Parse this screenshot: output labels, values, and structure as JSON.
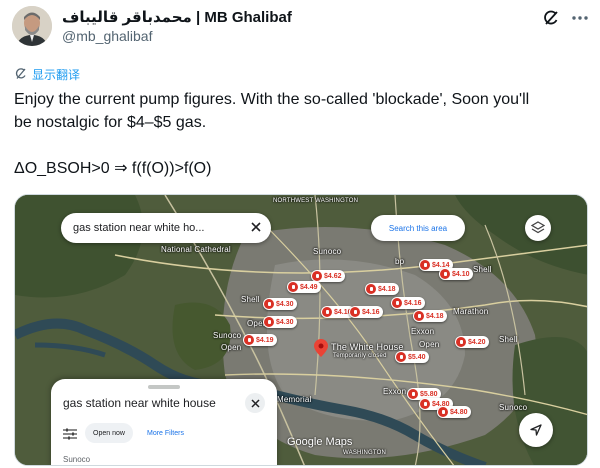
{
  "tweet": {
    "display_name": "محمدباقر قالیباف | MB Ghalibaf",
    "handle": "@mb_ghalibaf",
    "translate_label": "显示翻译",
    "text_lines": [
      "Enjoy the current pump figures. With the so-called 'blockade', Soon you'll",
      "be nostalgic for $4–$5 gas.",
      "",
      "ΔO_BSOH>0 ⇒ f(f(O))>f(O)"
    ]
  },
  "icons": {
    "grok": "grok-slash-icon",
    "more": "more-dots-icon",
    "translate": "translate-icon",
    "layers": "layers-icon",
    "close": "close-icon",
    "filter": "filter-sliders-icon",
    "navigate": "navigation-arrow-icon"
  },
  "map": {
    "search_query": "gas station near white ho...",
    "search_this_area": "Search this area",
    "panel_query": "gas station near white house",
    "open_now": "Open now",
    "more_filters": "More Filters",
    "peek_result": "Sunoco",
    "google_maps": "Google Maps",
    "labels": {
      "northwest_washington": "NORTHWEST WASHINGTON",
      "national_cathedral": "National Cathedral",
      "the_white_house": "The White House",
      "white_house_sub": "Temporarily closed",
      "memorial": "Memorial",
      "marathon": "Marathon",
      "sunoco_a": "Sunoco",
      "sunoco_b": "Sunoco",
      "sunoco_c": "Sunoco",
      "shell_a": "Shell",
      "shell_b": "Shell",
      "shell_c": "Shell",
      "exxon_a": "Exxon",
      "exxon_b": "Exxon",
      "bp": "bp",
      "open_a": "Open",
      "open_b": "Open",
      "open_c": "Open",
      "washington": "WASHINGTON"
    },
    "prices": {
      "p1": "$4.14",
      "p2": "$4.10",
      "p3": "$4.62",
      "p4": "$4.49",
      "p5": "$4.18",
      "p6": "$4.30",
      "p7": "$4.16",
      "p8": "$4.30",
      "p9": "$4.10",
      "p10": "$4.16",
      "p11": "$4.18",
      "p12": "$4.19",
      "p13": "$4.20",
      "p14": "$5.40",
      "p15": "$5.80",
      "p16": "$4.80",
      "p17": "$4.80"
    },
    "colors": {
      "pin_red": "#d93025",
      "link_blue": "#1a73e8",
      "twitter_blue": "#1d9bf0"
    }
  }
}
